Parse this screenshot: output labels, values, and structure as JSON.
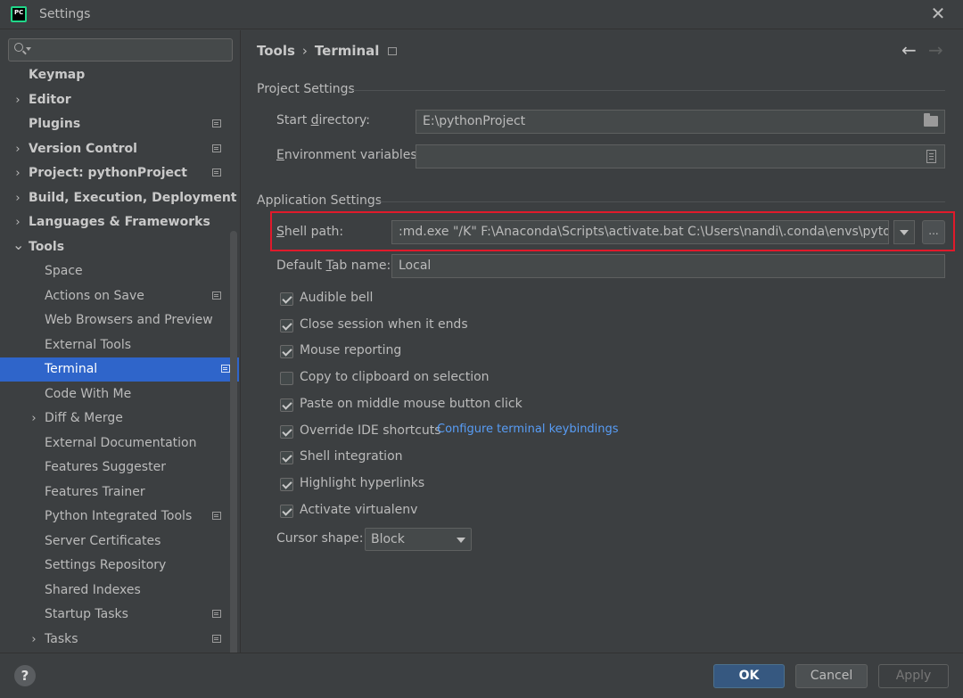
{
  "window": {
    "title": "Settings",
    "app_icon_text": "PC"
  },
  "search": {
    "placeholder": ""
  },
  "sidebar": {
    "items": [
      {
        "label": "Keymap",
        "level": 0,
        "bold": true,
        "arrow": "",
        "project_icon": false
      },
      {
        "label": "Editor",
        "level": 0,
        "bold": true,
        "arrow": ">",
        "project_icon": false
      },
      {
        "label": "Plugins",
        "level": 0,
        "bold": true,
        "arrow": "",
        "project_icon": true
      },
      {
        "label": "Version Control",
        "level": 0,
        "bold": true,
        "arrow": ">",
        "project_icon": true
      },
      {
        "label": "Project: pythonProject",
        "level": 0,
        "bold": true,
        "arrow": ">",
        "project_icon": true
      },
      {
        "label": "Build, Execution, Deployment",
        "level": 0,
        "bold": true,
        "arrow": ">",
        "project_icon": false
      },
      {
        "label": "Languages & Frameworks",
        "level": 0,
        "bold": true,
        "arrow": ">",
        "project_icon": false
      },
      {
        "label": "Tools",
        "level": 0,
        "bold": true,
        "arrow": "v",
        "project_icon": false
      },
      {
        "label": "Space",
        "level": 1,
        "bold": false,
        "arrow": "",
        "project_icon": false
      },
      {
        "label": "Actions on Save",
        "level": 1,
        "bold": false,
        "arrow": "",
        "project_icon": true
      },
      {
        "label": "Web Browsers and Preview",
        "level": 1,
        "bold": false,
        "arrow": "",
        "project_icon": false
      },
      {
        "label": "External Tools",
        "level": 1,
        "bold": false,
        "arrow": "",
        "project_icon": false
      },
      {
        "label": "Terminal",
        "level": 1,
        "bold": false,
        "arrow": "",
        "project_icon": true,
        "selected": true
      },
      {
        "label": "Code With Me",
        "level": 1,
        "bold": false,
        "arrow": "",
        "project_icon": false
      },
      {
        "label": "Diff & Merge",
        "level": 1,
        "bold": false,
        "arrow": ">",
        "project_icon": false
      },
      {
        "label": "External Documentation",
        "level": 1,
        "bold": false,
        "arrow": "",
        "project_icon": false
      },
      {
        "label": "Features Suggester",
        "level": 1,
        "bold": false,
        "arrow": "",
        "project_icon": false
      },
      {
        "label": "Features Trainer",
        "level": 1,
        "bold": false,
        "arrow": "",
        "project_icon": false
      },
      {
        "label": "Python Integrated Tools",
        "level": 1,
        "bold": false,
        "arrow": "",
        "project_icon": true
      },
      {
        "label": "Server Certificates",
        "level": 1,
        "bold": false,
        "arrow": "",
        "project_icon": false
      },
      {
        "label": "Settings Repository",
        "level": 1,
        "bold": false,
        "arrow": "",
        "project_icon": false
      },
      {
        "label": "Shared Indexes",
        "level": 1,
        "bold": false,
        "arrow": "",
        "project_icon": false
      },
      {
        "label": "Startup Tasks",
        "level": 1,
        "bold": false,
        "arrow": "",
        "project_icon": true
      },
      {
        "label": "Tasks",
        "level": 1,
        "bold": false,
        "arrow": ">",
        "project_icon": true
      }
    ]
  },
  "breadcrumb": {
    "parent": "Tools",
    "separator": "›",
    "current": "Terminal"
  },
  "project_settings": {
    "title": "Project Settings",
    "start_directory_label_pre": "Start ",
    "start_directory_label_mn": "d",
    "start_directory_label_post": "irectory:",
    "start_directory_value": "E:\\pythonProject",
    "env_label_pre": "",
    "env_label_mn": "E",
    "env_label_post": "nvironment variables:",
    "env_value": ""
  },
  "app_settings": {
    "title": "Application Settings",
    "shell_label_pre": "",
    "shell_label_mn": "S",
    "shell_label_post": "hell path:",
    "shell_value": ":md.exe \"/K\" F:\\Anaconda\\Scripts\\activate.bat C:\\Users\\nandi\\.conda\\envs\\pytorch-gpu",
    "browse_label": "...",
    "tab_label_pre": "Default ",
    "tab_label_mn": "T",
    "tab_label_post": "ab name:",
    "tab_value": "Local",
    "checkboxes": [
      {
        "label": "Audible bell",
        "checked": true
      },
      {
        "label": "Close session when it ends",
        "checked": true
      },
      {
        "label": "Mouse reporting",
        "checked": true
      },
      {
        "label": "Copy to clipboard on selection",
        "checked": false
      },
      {
        "label": "Paste on middle mouse button click",
        "checked": true
      },
      {
        "label": "Override IDE shortcuts",
        "checked": true
      },
      {
        "label": "Shell integration",
        "checked": true
      },
      {
        "label": "Highlight hyperlinks",
        "checked": true
      },
      {
        "label": "Activate virtualenv",
        "checked": true
      }
    ],
    "configure_link": "Configure terminal keybindings",
    "cursor_label": "Cursor shape:",
    "cursor_value": "Block"
  },
  "footer": {
    "help": "?",
    "ok": "OK",
    "cancel": "Cancel",
    "apply": "Apply"
  },
  "colors": {
    "background": "#3c3f41",
    "selection": "#2f65ca",
    "highlight_border": "#e01a2b",
    "link": "#589df6",
    "ok_button": "#365880"
  }
}
